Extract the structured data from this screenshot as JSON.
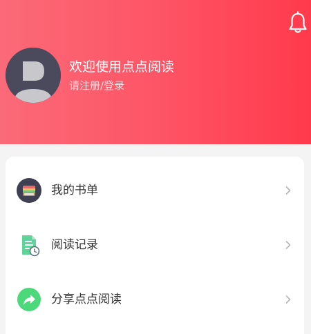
{
  "header": {
    "welcome_text": "欢迎使用点点阅读",
    "login_link": "请注册/登录",
    "notification_icon": "bell-icon",
    "avatar_icon": "default-avatar-icon"
  },
  "menu": {
    "items": [
      {
        "label": "我的书单",
        "icon": "booklist-icon"
      },
      {
        "label": "阅读记录",
        "icon": "reading-history-icon"
      },
      {
        "label": "分享点点阅读",
        "icon": "share-icon"
      }
    ]
  },
  "colors": {
    "header_gradient_start": "#fb6a78",
    "header_gradient_end": "#ff3a4c",
    "share_green": "#4cd97b",
    "record_green": "#5ed39a"
  }
}
